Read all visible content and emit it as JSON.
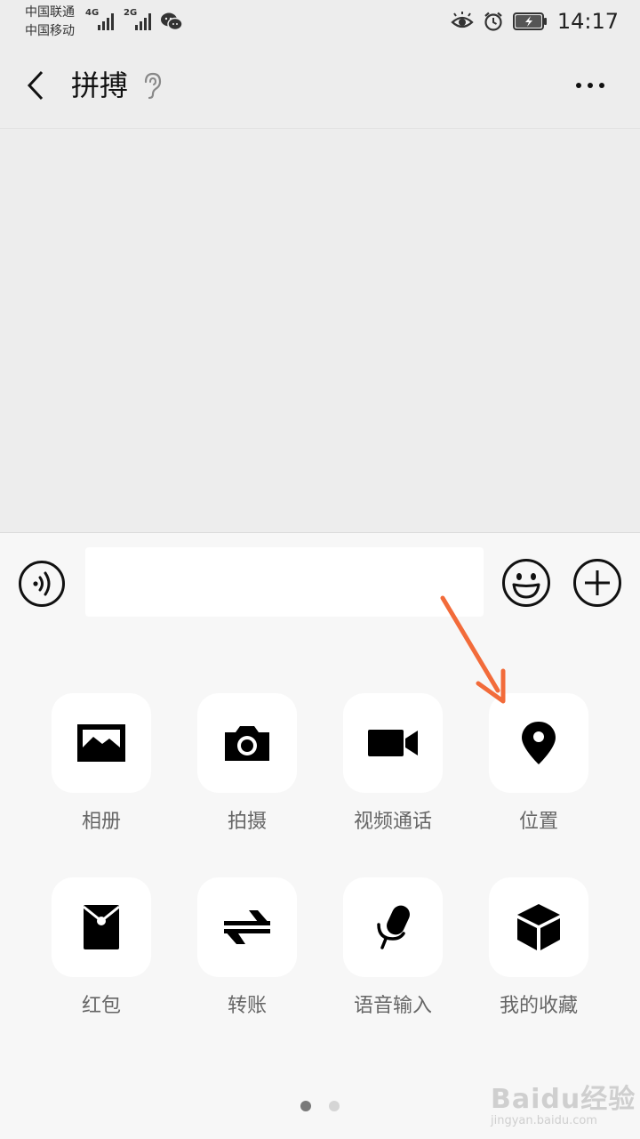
{
  "status": {
    "carrier_1": "中国联通",
    "carrier_2": "中国移动",
    "network_1": "4G",
    "network_2": "2G",
    "time": "14:17"
  },
  "header": {
    "title": "拼搏"
  },
  "input": {
    "value": "",
    "placeholder": ""
  },
  "panel": {
    "items": [
      {
        "label": "相册",
        "icon": "photo-album-icon"
      },
      {
        "label": "拍摄",
        "icon": "camera-icon"
      },
      {
        "label": "视频通话",
        "icon": "video-call-icon"
      },
      {
        "label": "位置",
        "icon": "location-pin-icon"
      },
      {
        "label": "红包",
        "icon": "red-packet-icon"
      },
      {
        "label": "转账",
        "icon": "transfer-icon"
      },
      {
        "label": "语音输入",
        "icon": "microphone-icon"
      },
      {
        "label": "我的收藏",
        "icon": "favorites-cube-icon"
      }
    ],
    "page_count": 2,
    "current_page": 1
  },
  "watermark": {
    "brand": "Baidu经验",
    "url": "jingyan.baidu.com"
  },
  "colors": {
    "background": "#ededed",
    "panel": "#f7f7f7",
    "annotation_arrow": "#f26b3a"
  }
}
